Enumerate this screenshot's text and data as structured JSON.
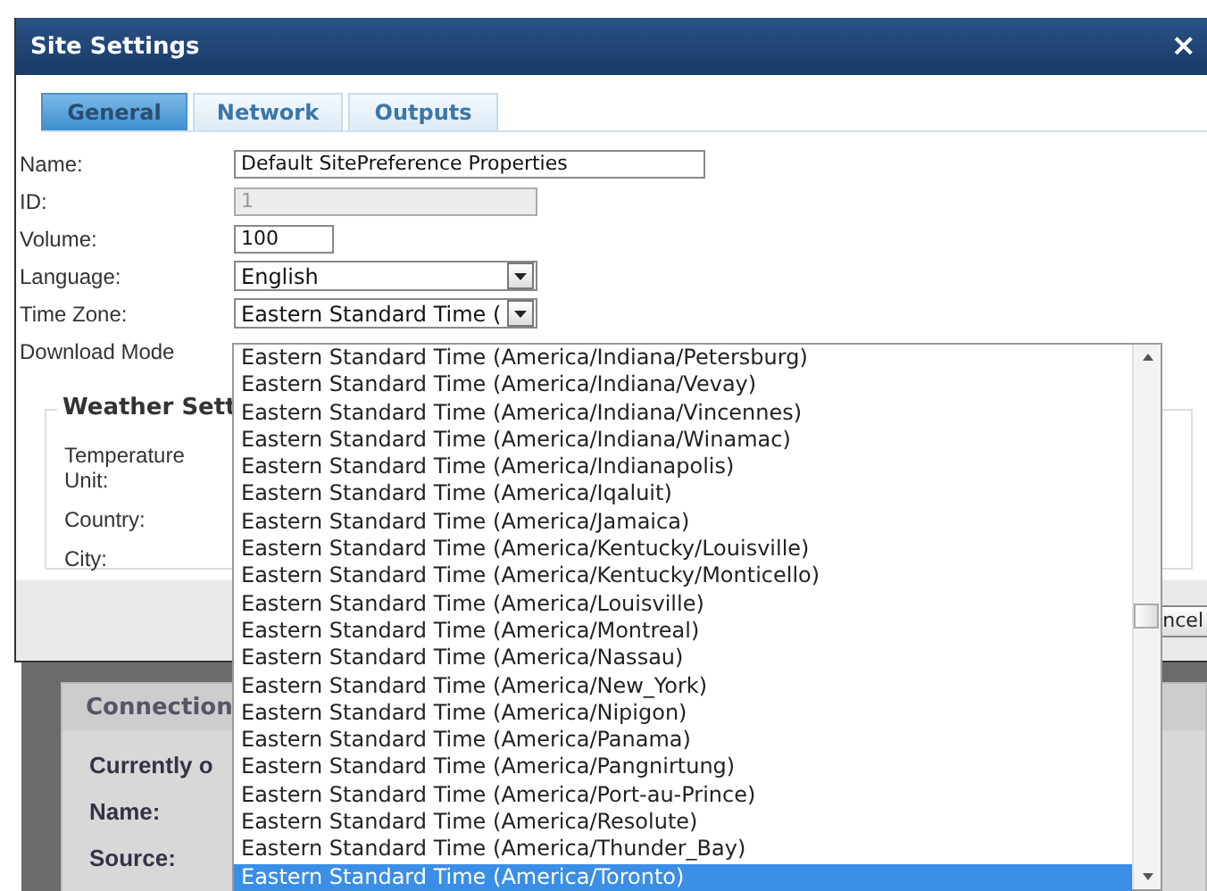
{
  "window": {
    "title": "Site Settings",
    "close": "×"
  },
  "tabs": [
    {
      "label": "General",
      "selected": true
    },
    {
      "label": "Network",
      "selected": false
    },
    {
      "label": "Outputs",
      "selected": false
    }
  ],
  "fields": [
    {
      "label": "Name:",
      "kind": "text",
      "value": "Default SitePreference Properties",
      "disabled": false
    },
    {
      "label": "ID:",
      "kind": "medium",
      "value": "1",
      "disabled": true
    },
    {
      "label": "Volume:",
      "kind": "short",
      "value": "100"
    },
    {
      "label": "Language:",
      "kind": "select",
      "value": "English"
    },
    {
      "label": "Time Zone:",
      "kind": "select",
      "value": "Eastern Standard Time ("
    },
    {
      "label": "Download Mode",
      "kind": "covered"
    }
  ],
  "weather": {
    "legend": "Weather Sett",
    "labels": [
      "Temperature Unit:",
      "Country:",
      "City:"
    ]
  },
  "footer": {
    "button": "ncel"
  },
  "timezone_list": [
    {
      "label": "Eastern Standard Time (America/Indiana/Petersburg)",
      "selected": false
    },
    {
      "label": "Eastern Standard Time (America/Indiana/Vevay)",
      "selected": false
    },
    {
      "label": "Eastern Standard Time (America/Indiana/Vincennes)",
      "selected": false
    },
    {
      "label": "Eastern Standard Time (America/Indiana/Winamac)",
      "selected": false
    },
    {
      "label": "Eastern Standard Time (America/Indianapolis)",
      "selected": false
    },
    {
      "label": "Eastern Standard Time (America/Iqaluit)",
      "selected": false
    },
    {
      "label": "Eastern Standard Time (America/Jamaica)",
      "selected": false
    },
    {
      "label": "Eastern Standard Time (America/Kentucky/Louisville)",
      "selected": false
    },
    {
      "label": "Eastern Standard Time (America/Kentucky/Monticello)",
      "selected": false
    },
    {
      "label": "Eastern Standard Time (America/Louisville)",
      "selected": false
    },
    {
      "label": "Eastern Standard Time (America/Montreal)",
      "selected": false
    },
    {
      "label": "Eastern Standard Time (America/Nassau)",
      "selected": false
    },
    {
      "label": "Eastern Standard Time (America/New_York)",
      "selected": false
    },
    {
      "label": "Eastern Standard Time (America/Nipigon)",
      "selected": false
    },
    {
      "label": "Eastern Standard Time (America/Panama)",
      "selected": false
    },
    {
      "label": "Eastern Standard Time (America/Pangnirtung)",
      "selected": false
    },
    {
      "label": "Eastern Standard Time (America/Port-au-Prince)",
      "selected": false
    },
    {
      "label": "Eastern Standard Time (America/Resolute)",
      "selected": false
    },
    {
      "label": "Eastern Standard Time (America/Thunder_Bay)",
      "selected": false
    },
    {
      "label": "Eastern Standard Time (America/Toronto)",
      "selected": true
    }
  ],
  "background_panel": {
    "header": "Connection",
    "subheader": "Currently o",
    "labels": [
      "Name:",
      "Source:"
    ]
  }
}
